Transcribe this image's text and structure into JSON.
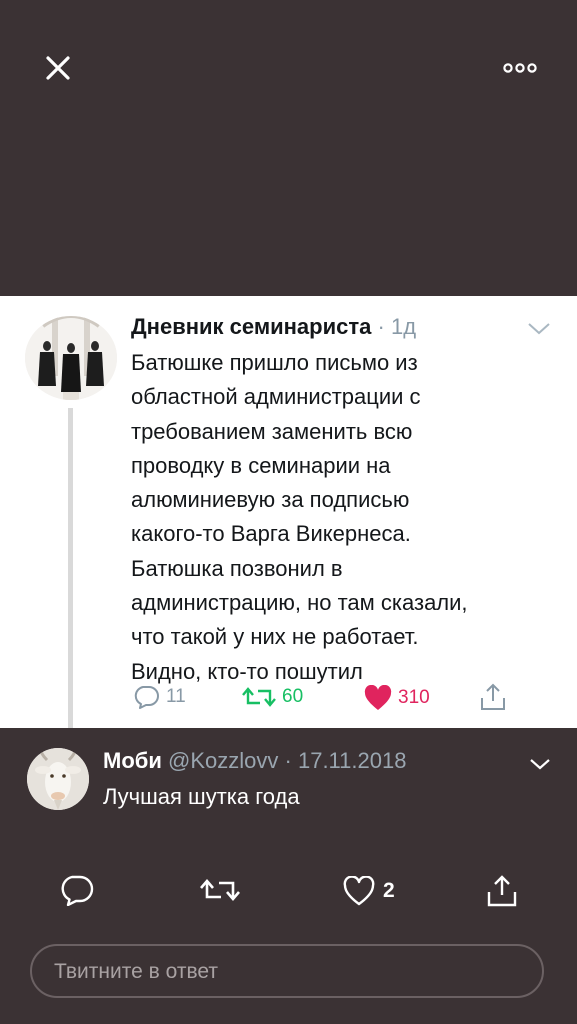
{
  "quoted_tweet": {
    "author_name": "Дневник семинариста",
    "separator": "·",
    "time": "1д",
    "text_lines": [
      "Батюшке пришло письмо из",
      "областной администрации с",
      "требованием заменить всю",
      "проводку в семинарии на",
      "алюминиевую за подписью",
      "какого-то Варга Викернеса.",
      "Батюшка позвонил в",
      "администрацию, но там сказали,",
      "что такой у них не работает.",
      "Видно, кто-то пошутил"
    ],
    "replies": "11",
    "retweets": "60",
    "likes": "310",
    "retweet_color": "#17bf63",
    "like_color": "#e0245e"
  },
  "reply_tweet": {
    "author_name": "Моби",
    "handle": "@Kozzlovv",
    "separator": "·",
    "date": "17.11.2018",
    "text": "Лучшая шутка года",
    "likes": "2"
  },
  "composer": {
    "placeholder": "Твитните в ответ"
  },
  "icons": [
    "close-icon",
    "more-icon",
    "chevron-down-icon",
    "reply-icon",
    "retweet-icon",
    "heart-icon",
    "share-icon"
  ],
  "colors": {
    "background": "#3b3234",
    "card": "#ffffff",
    "muted": "#8899a6"
  }
}
